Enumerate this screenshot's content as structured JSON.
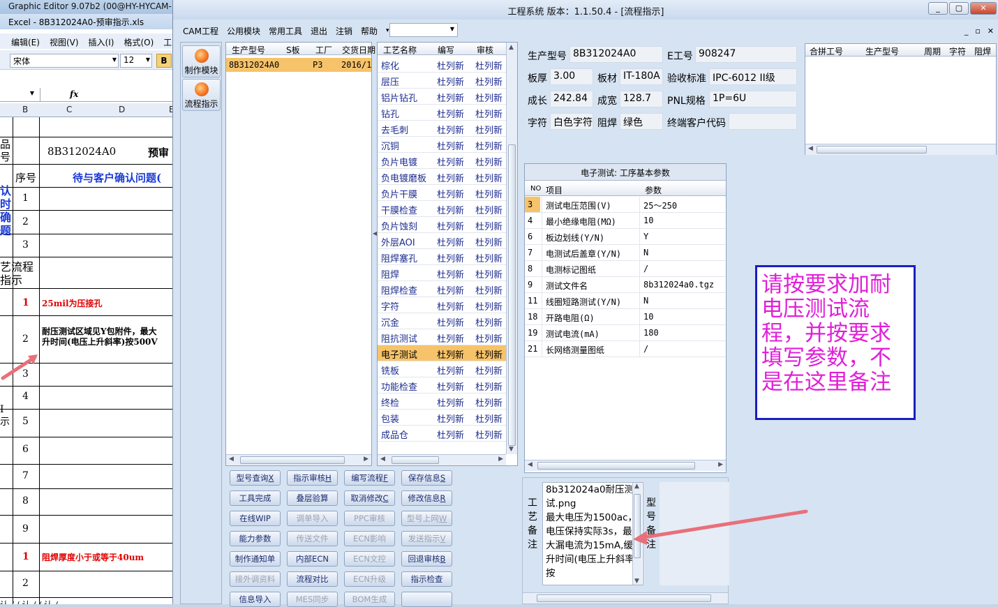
{
  "background": {
    "title_a": "Graphic Editor 9.07b2 (00@HY-HYCAM-P",
    "title_b": "Excel - 8B312024A0-预审指示.xls",
    "menu": [
      "编辑(E)",
      "视图(V)",
      "插入(I)",
      "格式(O)",
      "工"
    ],
    "font_name": "宋体",
    "font_size": "12",
    "bold": "B",
    "fx": "fx",
    "cols": [
      "B",
      "C",
      "D",
      "E"
    ],
    "sheet": {
      "label_a": "品\n号",
      "model": "8B312024A0",
      "preaudit": "预审",
      "seq_header": "序号",
      "pending_header": "待与客户确认问题(",
      "side_label": "认\n时\n确\n题",
      "row_nums_a": [
        "1",
        "2",
        "3"
      ],
      "flow_label": "艺流程\n指示",
      "rows": [
        {
          "n": "1",
          "text": "25mil为压接孔",
          "style": "red"
        },
        {
          "n": "2",
          "text": "耐压测试区域见Y包附件，最大\n升时间(电压上升斜率)按500V",
          "style": "black"
        },
        {
          "n": "3",
          "text": ""
        },
        {
          "n": "4",
          "text": ""
        },
        {
          "n": "5",
          "text": ""
        },
        {
          "n": "6",
          "text": ""
        },
        {
          "n": "7",
          "text": ""
        },
        {
          "n": "8",
          "text": ""
        },
        {
          "n": "9",
          "text": ""
        },
        {
          "n": "1",
          "text": "阻焊厚度小于或等于40um",
          "style": "red"
        },
        {
          "n": "2",
          "text": ""
        }
      ],
      "side_label_b": "I\n示",
      "bottom_text": "认 /  / 认 /  / 认 /"
    }
  },
  "window": {
    "title": "工程系统   版本：1.1.50.4 - [流程指示]",
    "menu": [
      "CAM工程",
      "公用模块",
      "常用工具",
      "退出",
      "注销",
      "帮助"
    ],
    "menu_more": "▾",
    "combo_value": "",
    "mdi_controls": [
      "_",
      "▫",
      "✕"
    ],
    "title_controls": [
      "_",
      "▢",
      "✕"
    ]
  },
  "tools": [
    {
      "label": "制作模块",
      "icon": "flame-icon"
    },
    {
      "label": "流程指示",
      "icon": "flow-icon"
    }
  ],
  "orders": {
    "headers": [
      "生产型号",
      "S板",
      "工厂",
      "交货日期"
    ],
    "rows": [
      {
        "model": "8B312024A0",
        "s": "",
        "factory": "P3",
        "date": "2016/1"
      }
    ]
  },
  "process": {
    "headers": [
      "工艺名称",
      "编写",
      "审核"
    ],
    "selected": "电子测试",
    "rows": [
      [
        "棕化",
        "杜列新",
        "杜列新"
      ],
      [
        "层压",
        "杜列新",
        "杜列新"
      ],
      [
        "铝片钻孔",
        "杜列新",
        "杜列新"
      ],
      [
        "钻孔",
        "杜列新",
        "杜列新"
      ],
      [
        "去毛刺",
        "杜列新",
        "杜列新"
      ],
      [
        "沉铜",
        "杜列新",
        "杜列新"
      ],
      [
        "负片电镀",
        "杜列新",
        "杜列新"
      ],
      [
        "负电镀磨板",
        "杜列新",
        "杜列新"
      ],
      [
        "负片干膜",
        "杜列新",
        "杜列新"
      ],
      [
        "干膜检查",
        "杜列新",
        "杜列新"
      ],
      [
        "负片蚀刻",
        "杜列新",
        "杜列新"
      ],
      [
        "外层AOI",
        "杜列新",
        "杜列新"
      ],
      [
        "阻焊塞孔",
        "杜列新",
        "杜列新"
      ],
      [
        "阻焊",
        "杜列新",
        "杜列新"
      ],
      [
        "阻焊检查",
        "杜列新",
        "杜列新"
      ],
      [
        "字符",
        "杜列新",
        "杜列新"
      ],
      [
        "沉金",
        "杜列新",
        "杜列新"
      ],
      [
        "阻抗测试",
        "杜列新",
        "杜列新"
      ],
      [
        "电子测试",
        "杜列新",
        "杜列新"
      ],
      [
        "铣板",
        "杜列新",
        "杜列新"
      ],
      [
        "功能检查",
        "杜列新",
        "杜列新"
      ],
      [
        "终检",
        "杜列新",
        "杜列新"
      ],
      [
        "包装",
        "杜列新",
        "杜列新"
      ],
      [
        "成品仓",
        "杜列新",
        "杜列新"
      ]
    ]
  },
  "info": {
    "model_label": "生产型号",
    "model": "8B312024A0",
    "e_label": "E工号",
    "e": "908247",
    "thick_label": "板厚",
    "thick": "3.00",
    "mat_label": "板材",
    "mat": "IT-180A",
    "std_label": "验收标准",
    "std": "IPC-6012 II级",
    "len_label": "成长",
    "len": "242.84",
    "wid_label": "成宽",
    "wid": "128.7",
    "pnl_label": "PNL规格",
    "pnl": "1P=6U",
    "char_label": "字符",
    "char": "白色字符",
    "mask_label": "阻焊",
    "mask": "绿色",
    "cust_label": "终端客户代码",
    "cust": ""
  },
  "merge": {
    "headers": [
      "合拼工号",
      "生产型号",
      "周期",
      "字符",
      "阻焊"
    ]
  },
  "params": {
    "title": "电子测试: 工序基本参数",
    "headers": [
      "NO",
      "项目",
      "参数"
    ],
    "rows": [
      [
        "3",
        "测试电压范围(V)",
        "25～250"
      ],
      [
        "4",
        "最小绝缘电阻(MΩ)",
        "10"
      ],
      [
        "6",
        "板边划线(Y/N)",
        "Y"
      ],
      [
        "7",
        "电测试后盖章(Y/N)",
        "N"
      ],
      [
        "8",
        "电测标记图纸",
        "/"
      ],
      [
        "9",
        "测试文件名",
        "8b312024a0.tgz"
      ],
      [
        "11",
        "线圈短路测试(Y/N)",
        "N"
      ],
      [
        "18",
        "开路电阻(Ω)",
        "10"
      ],
      [
        "19",
        "测试电流(mA)",
        "180"
      ],
      [
        "21",
        "长网络测量图纸",
        "/"
      ]
    ]
  },
  "note": "请按要求加耐电压测试流程，并按要求填写参数，不是在这里备注",
  "buttons": [
    [
      {
        "label": "型号查询",
        "key": "X"
      },
      {
        "label": "指示审核",
        "key": "H"
      },
      {
        "label": "编写流程",
        "key": "F"
      },
      {
        "label": "保存信息",
        "key": "S"
      }
    ],
    [
      {
        "label": "工具完成",
        "key": ""
      },
      {
        "label": "叠层验算",
        "key": ""
      },
      {
        "label": "取消修改",
        "key": "C"
      },
      {
        "label": "修改信息",
        "key": "R"
      }
    ],
    [
      {
        "label": "在线WIP",
        "key": ""
      },
      {
        "label": "调单导入",
        "key": "",
        "disabled": true
      },
      {
        "label": "PPC审核",
        "key": "",
        "disabled": true
      },
      {
        "label": "型号上网",
        "key": "W",
        "disabled": true
      }
    ],
    [
      {
        "label": "能力参数",
        "key": ""
      },
      {
        "label": "传送文件",
        "key": "",
        "disabled": true
      },
      {
        "label": "ECN影响",
        "key": "",
        "disabled": true
      },
      {
        "label": "发送指示",
        "key": "V",
        "disabled": true
      }
    ],
    [
      {
        "label": "制作通知单",
        "key": ""
      },
      {
        "label": "内部ECN",
        "key": ""
      },
      {
        "label": "ECN文控",
        "key": "",
        "disabled": true
      },
      {
        "label": "回退审核",
        "key": "B"
      }
    ],
    [
      {
        "label": "接外调资料",
        "key": "",
        "disabled": true
      },
      {
        "label": "流程对比",
        "key": ""
      },
      {
        "label": "ECN升级",
        "key": "",
        "disabled": true
      },
      {
        "label": "指示检查",
        "key": ""
      }
    ],
    [
      {
        "label": "信息导入",
        "key": ""
      },
      {
        "label": "MES同步",
        "key": "",
        "disabled": true
      },
      {
        "label": "BOM生成",
        "key": "",
        "disabled": true
      },
      {
        "label": "",
        "key": ""
      }
    ]
  ],
  "remark": {
    "left_label": "工艺备注",
    "right_label": "型号备注",
    "text": "8b312024a0耐压测试.png\n最大电压为1500ac，电压保持实际3s，最大漏电流为15mA,缓升时间(电压上升斜率)按"
  },
  "colors": {
    "accent": "#f7c36a",
    "note_text": "#e020d8",
    "note_border": "#1a1fbf",
    "arrow": "#e8707a"
  }
}
